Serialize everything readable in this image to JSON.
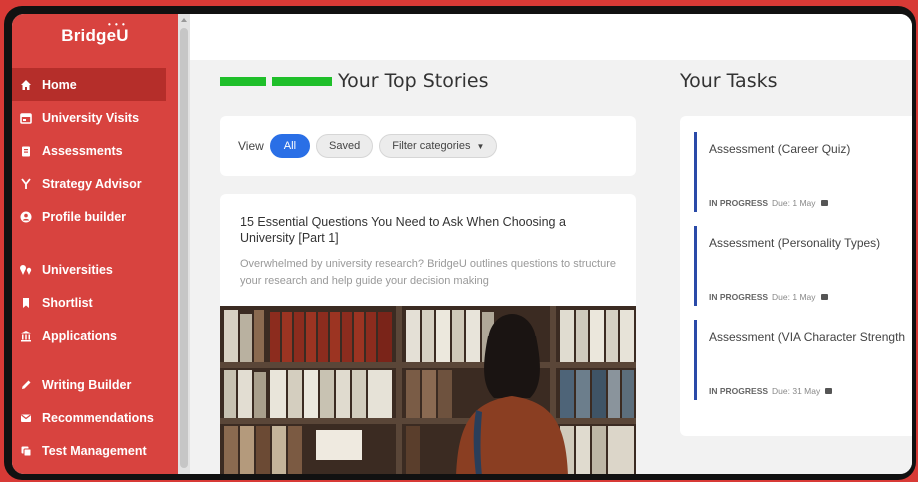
{
  "brand": {
    "name": "BridgeU"
  },
  "sidebar": {
    "items": [
      {
        "label": "Home",
        "icon": "home-icon",
        "active": true
      },
      {
        "label": "University Visits",
        "icon": "calendar-icon"
      },
      {
        "label": "Assessments",
        "icon": "clipboard-icon"
      },
      {
        "label": "Strategy Advisor",
        "icon": "branch-icon"
      },
      {
        "label": "Profile builder",
        "icon": "user-circle-icon"
      },
      {
        "label": "Universities",
        "icon": "pins-icon"
      },
      {
        "label": "Shortlist",
        "icon": "bookmark-icon"
      },
      {
        "label": "Applications",
        "icon": "institution-icon"
      },
      {
        "label": "Writing Builder",
        "icon": "pencil-icon"
      },
      {
        "label": "Recommendations",
        "icon": "envelope-icon"
      },
      {
        "label": "Test Management",
        "icon": "copy-icon"
      }
    ]
  },
  "stories": {
    "title": "Your Top Stories",
    "view_label": "View",
    "filters": {
      "all": "All",
      "saved": "Saved",
      "categories": "Filter categories"
    },
    "card": {
      "title": "15 Essential Questions You Need to Ask When Choosing a University [Part 1]",
      "description": "Overwhelmed by university research? BridgeU outlines questions to structure your research and help guide your decision making"
    }
  },
  "tasks": {
    "title": "Your Tasks",
    "items": [
      {
        "name": "Assessment (Career Quiz)",
        "status": "IN PROGRESS",
        "due": "Due: 1 May"
      },
      {
        "name": "Assessment (Personality Types)",
        "status": "IN PROGRESS",
        "due": "Due: 1 May"
      },
      {
        "name": "Assessment (VIA Character Strength",
        "status": "IN PROGRESS",
        "due": "Due: 31 May"
      }
    ]
  },
  "colors": {
    "sidebar": "#d8433f",
    "sidebar_active": "#b52e2a",
    "accent_blue": "#2a6fe6",
    "task_bar": "#2a4aa8",
    "redaction": "#1fbf2a"
  }
}
